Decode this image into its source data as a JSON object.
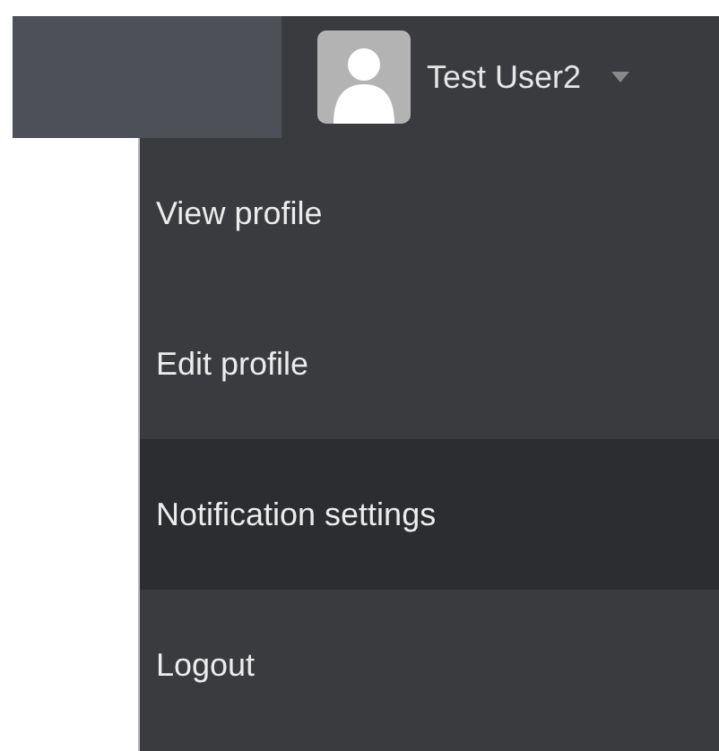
{
  "user_menu": {
    "name": "Test User2"
  },
  "dropdown": {
    "items": [
      {
        "label": "View profile",
        "selected": false
      },
      {
        "label": "Edit profile",
        "selected": false
      },
      {
        "label": "Notification settings",
        "selected": true
      },
      {
        "label": "Logout",
        "selected": false
      }
    ]
  }
}
